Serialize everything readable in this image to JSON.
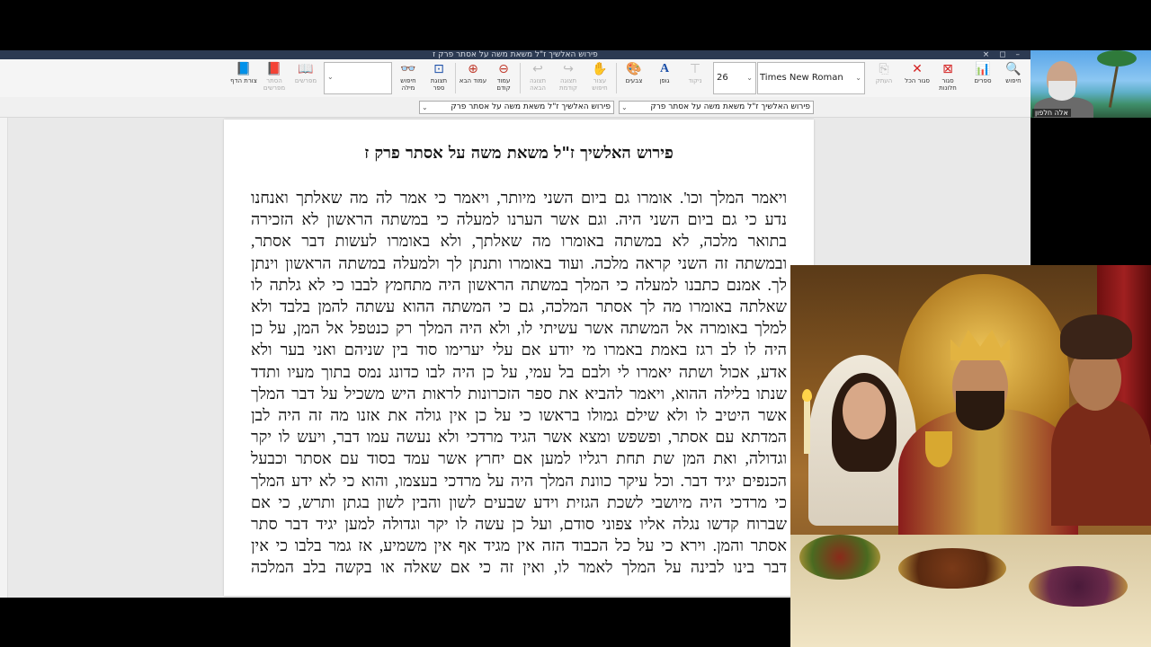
{
  "window": {
    "title": "פירוש האלשיך ז\"ל משאת משה על אסתר פרק ז",
    "controls": "– ◻ ×"
  },
  "ribbon": {
    "buttons": [
      {
        "id": "search",
        "label": "חיפוש",
        "icon": "🔍",
        "enabled": true
      },
      {
        "id": "books",
        "label": "ספרים",
        "icon": "📊",
        "enabled": true
      },
      {
        "id": "close-windows",
        "label": "סגור חלונות",
        "icon": "⊠",
        "enabled": true
      },
      {
        "id": "close-all",
        "label": "סגור הכל",
        "icon": "✕",
        "enabled": true
      },
      {
        "id": "copy",
        "label": "העתק",
        "icon": "⎘",
        "enabled": false
      },
      {
        "id": "nikud",
        "label": "ניקוד",
        "icon": "ֹ",
        "enabled": false
      },
      {
        "id": "font",
        "label": "גופן",
        "icon": "A",
        "enabled": true
      },
      {
        "id": "colors",
        "label": "צבעים",
        "icon": "🎨",
        "enabled": true
      },
      {
        "id": "stop-search",
        "label": "עצור חיפוש",
        "icon": "✋",
        "enabled": false
      },
      {
        "id": "forward",
        "label": "תצוגה קודמת",
        "icon": "↪",
        "enabled": false
      },
      {
        "id": "back",
        "label": "תצוגה הבאה",
        "icon": "↩",
        "enabled": false
      },
      {
        "id": "prev-page",
        "label": "עמוד קודם",
        "icon": "⊖",
        "enabled": true
      },
      {
        "id": "next-page",
        "label": "עמוד הבא",
        "icon": "⊕",
        "enabled": true
      },
      {
        "id": "book-view",
        "label": "תצוגת ספר",
        "icon": "⊡",
        "enabled": true
      },
      {
        "id": "word-search",
        "label": "חיפוש מילה",
        "icon": "👓",
        "enabled": true
      },
      {
        "id": "commentaries",
        "label": "מפרשים",
        "icon": "📖",
        "enabled": false
      },
      {
        "id": "hide-commentaries",
        "label": "הסתר מפרשים",
        "icon": "📕",
        "enabled": false
      },
      {
        "id": "page-shape",
        "label": "צורת הדף",
        "icon": "📘",
        "enabled": true
      }
    ],
    "font_size": "26",
    "font_name": "Times New Roman"
  },
  "tabs": {
    "selected": "פירוש האלשיך ז\"ל משאת משה על אסתר פרק",
    "current": "פירוש האלשיך ז\"ל משאת משה על אסתר פרק"
  },
  "document": {
    "title": "פירוש האלשיך ז\"ל משאת משה על אסתר פרק ז",
    "lines": [
      "ויאמר המלך וכו'. אומרו גם ביום השני מיותר, ויאמר כי אמר לה מה שאלתך ואנחנו",
      "נדע כי גם ביום השני היה. וגם אשר הערנו למעלה כי במשתה הראשון לא הזכירה",
      "בתואר מלכה, לא במשתה באומרו מה שאלתך, ולא באומרו לעשות דבר אסתר,",
      "ובמשתה זה השני קראה מלכה. ועוד באומרו ותנתן לך ולמעלה במשתה הראשון וינתן",
      "לך. אמנם כתבנו למעלה כי המלך במשתה הראשון היה מתחמץ לבבו כי לא גלתה לו",
      "שאלתה באומרו מה לך אסתר המלכה, גם כי המשתה ההוא עשתה להמן בלבד ולא",
      "למלך באומרה אל המשתה אשר עשיתי לו, ולא היה המלך רק כנטפל אל המן, על כן",
      "היה לו לב רגז באמת באמרו מי יודע אם עלי יערימו סוד בין שניהם ואני בער ולא",
      "אדע, אכול ושתה יאמרו לי ולבם בל עמי, על כן היה לבו כדונג נמס בתוך מעיו ותדד",
      "שנתו בלילה ההוא, ויאמר להביא את ספר הזכרונות לראות היש משכיל על דבר המלך",
      "אשר היטיב לו ולא שילם גמולו בראשו כי על כן אין גולה את אזנו מה זה היה לבן",
      "המדתא עם אסתר, ופשפש ומצא אשר הגיד מרדכי ולא נעשה עמו דבר, ויעש לו יקר",
      "וגדולה, ואת המן שת תחת רגליו למען אם יחרץ אשר עמד בסוד עם אסתר וכבעל",
      "הכנפים יגיד דבר. וכל עיקר כוונת המלך היה על מרדכי בעצמו, והוא כי לא ידע המלך",
      "כי מרדכי היה מיושבי לשכת הגזית וידע שבעים לשון והבין לשון בגתן ותרש, כי אם",
      "שברוח קדשו נגלה אליו צפוני סודם, ועל כן עשה לו יקר וגדולה למען יגיד דבר סתר",
      "אסתר והמן. וירא כי על כל הכבוד הזה אין מגיד אף אין משמיע, אז גמר בלבו כי אין",
      "דבר בינו לבינה על המלך לאמר לו, ואין זה כי אם שאלה או בקשה בלב המלכה"
    ]
  },
  "webcam": {
    "name": "אלה חלפון"
  },
  "colors": {
    "close_red": "#d42020",
    "accent_blue": "#1b4fa8",
    "titlebar": "#2c3a52"
  }
}
